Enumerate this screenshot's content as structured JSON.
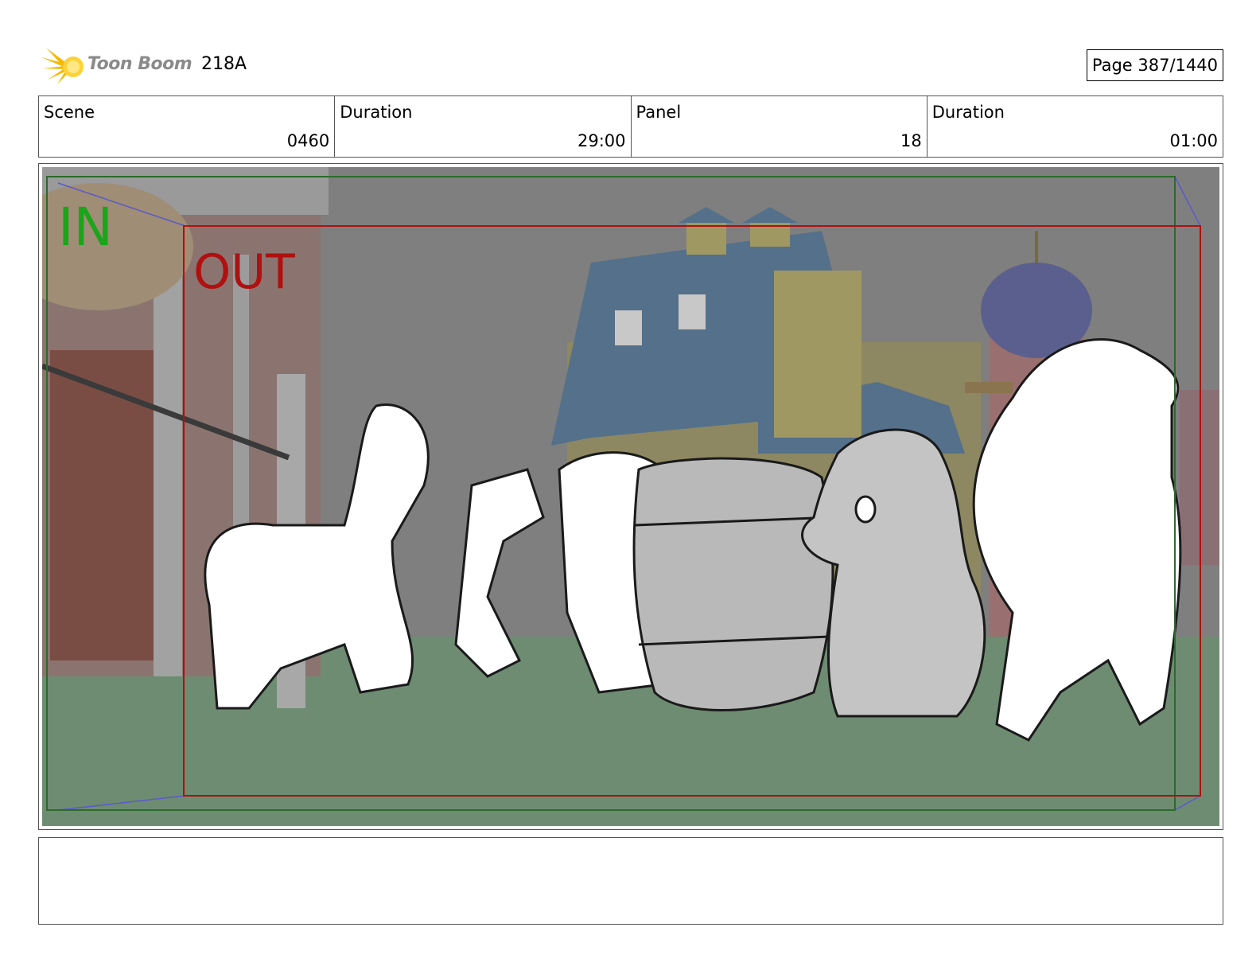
{
  "header": {
    "logo_text": "Toon Boom",
    "episode": "218A",
    "page_label": "Page",
    "page_value": "387/1440"
  },
  "info": {
    "scene_label": "Scene",
    "scene_value": "0460",
    "scene_duration_label": "Duration",
    "scene_duration_value": "29:00",
    "panel_label": "Panel",
    "panel_value": "18",
    "panel_duration_label": "Duration",
    "panel_duration_value": "01:00"
  },
  "frame": {
    "in_label": "IN",
    "out_label": "OUT",
    "colors": {
      "in": "#1aa51a",
      "out": "#b01010",
      "in_frame": "#2b6b2b",
      "out_frame": "#b01010",
      "arrow": "#5a5acc",
      "sky": "#808080",
      "ground": "#6e8c72"
    }
  },
  "notes": {
    "text": ""
  }
}
